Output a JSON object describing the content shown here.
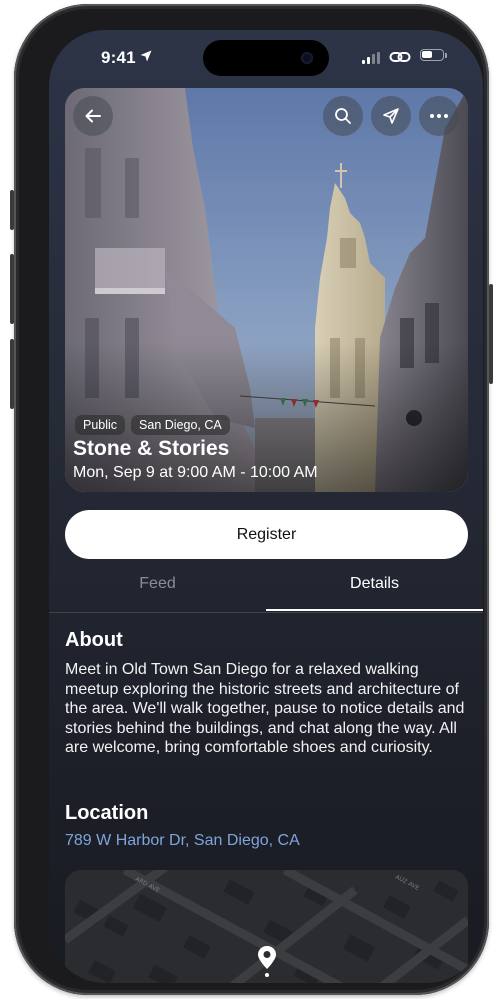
{
  "status_bar": {
    "time": "9:41"
  },
  "hero": {
    "chips": [
      "Public",
      "San Diego, CA"
    ],
    "title": "Stone & Stories",
    "datetime": "Mon, Sep 9 at 9:00 AM - 10:00 AM"
  },
  "register_label": "Register",
  "tabs": [
    {
      "label": "Feed",
      "active": false
    },
    {
      "label": "Details",
      "active": true
    }
  ],
  "about": {
    "heading": "About",
    "text": "Meet in Old Town San Diego for a relaxed walking meetup exploring the historic streets and architecture of the area. We'll walk together, pause to notice details and stories behind the buildings, and chat along the way. All are welcome, bring comfortable shoes and curiosity."
  },
  "location": {
    "heading": "Location",
    "address": "789 W Harbor Dr, San Diego, CA"
  },
  "colors": {
    "accent_link": "#7fa4dd",
    "background": "#262b38",
    "button": "#ffffff"
  },
  "icons": [
    "back-arrow-icon",
    "search-icon",
    "share-icon",
    "more-icon",
    "map-pin-icon",
    "location-arrow-icon",
    "link-icon"
  ]
}
